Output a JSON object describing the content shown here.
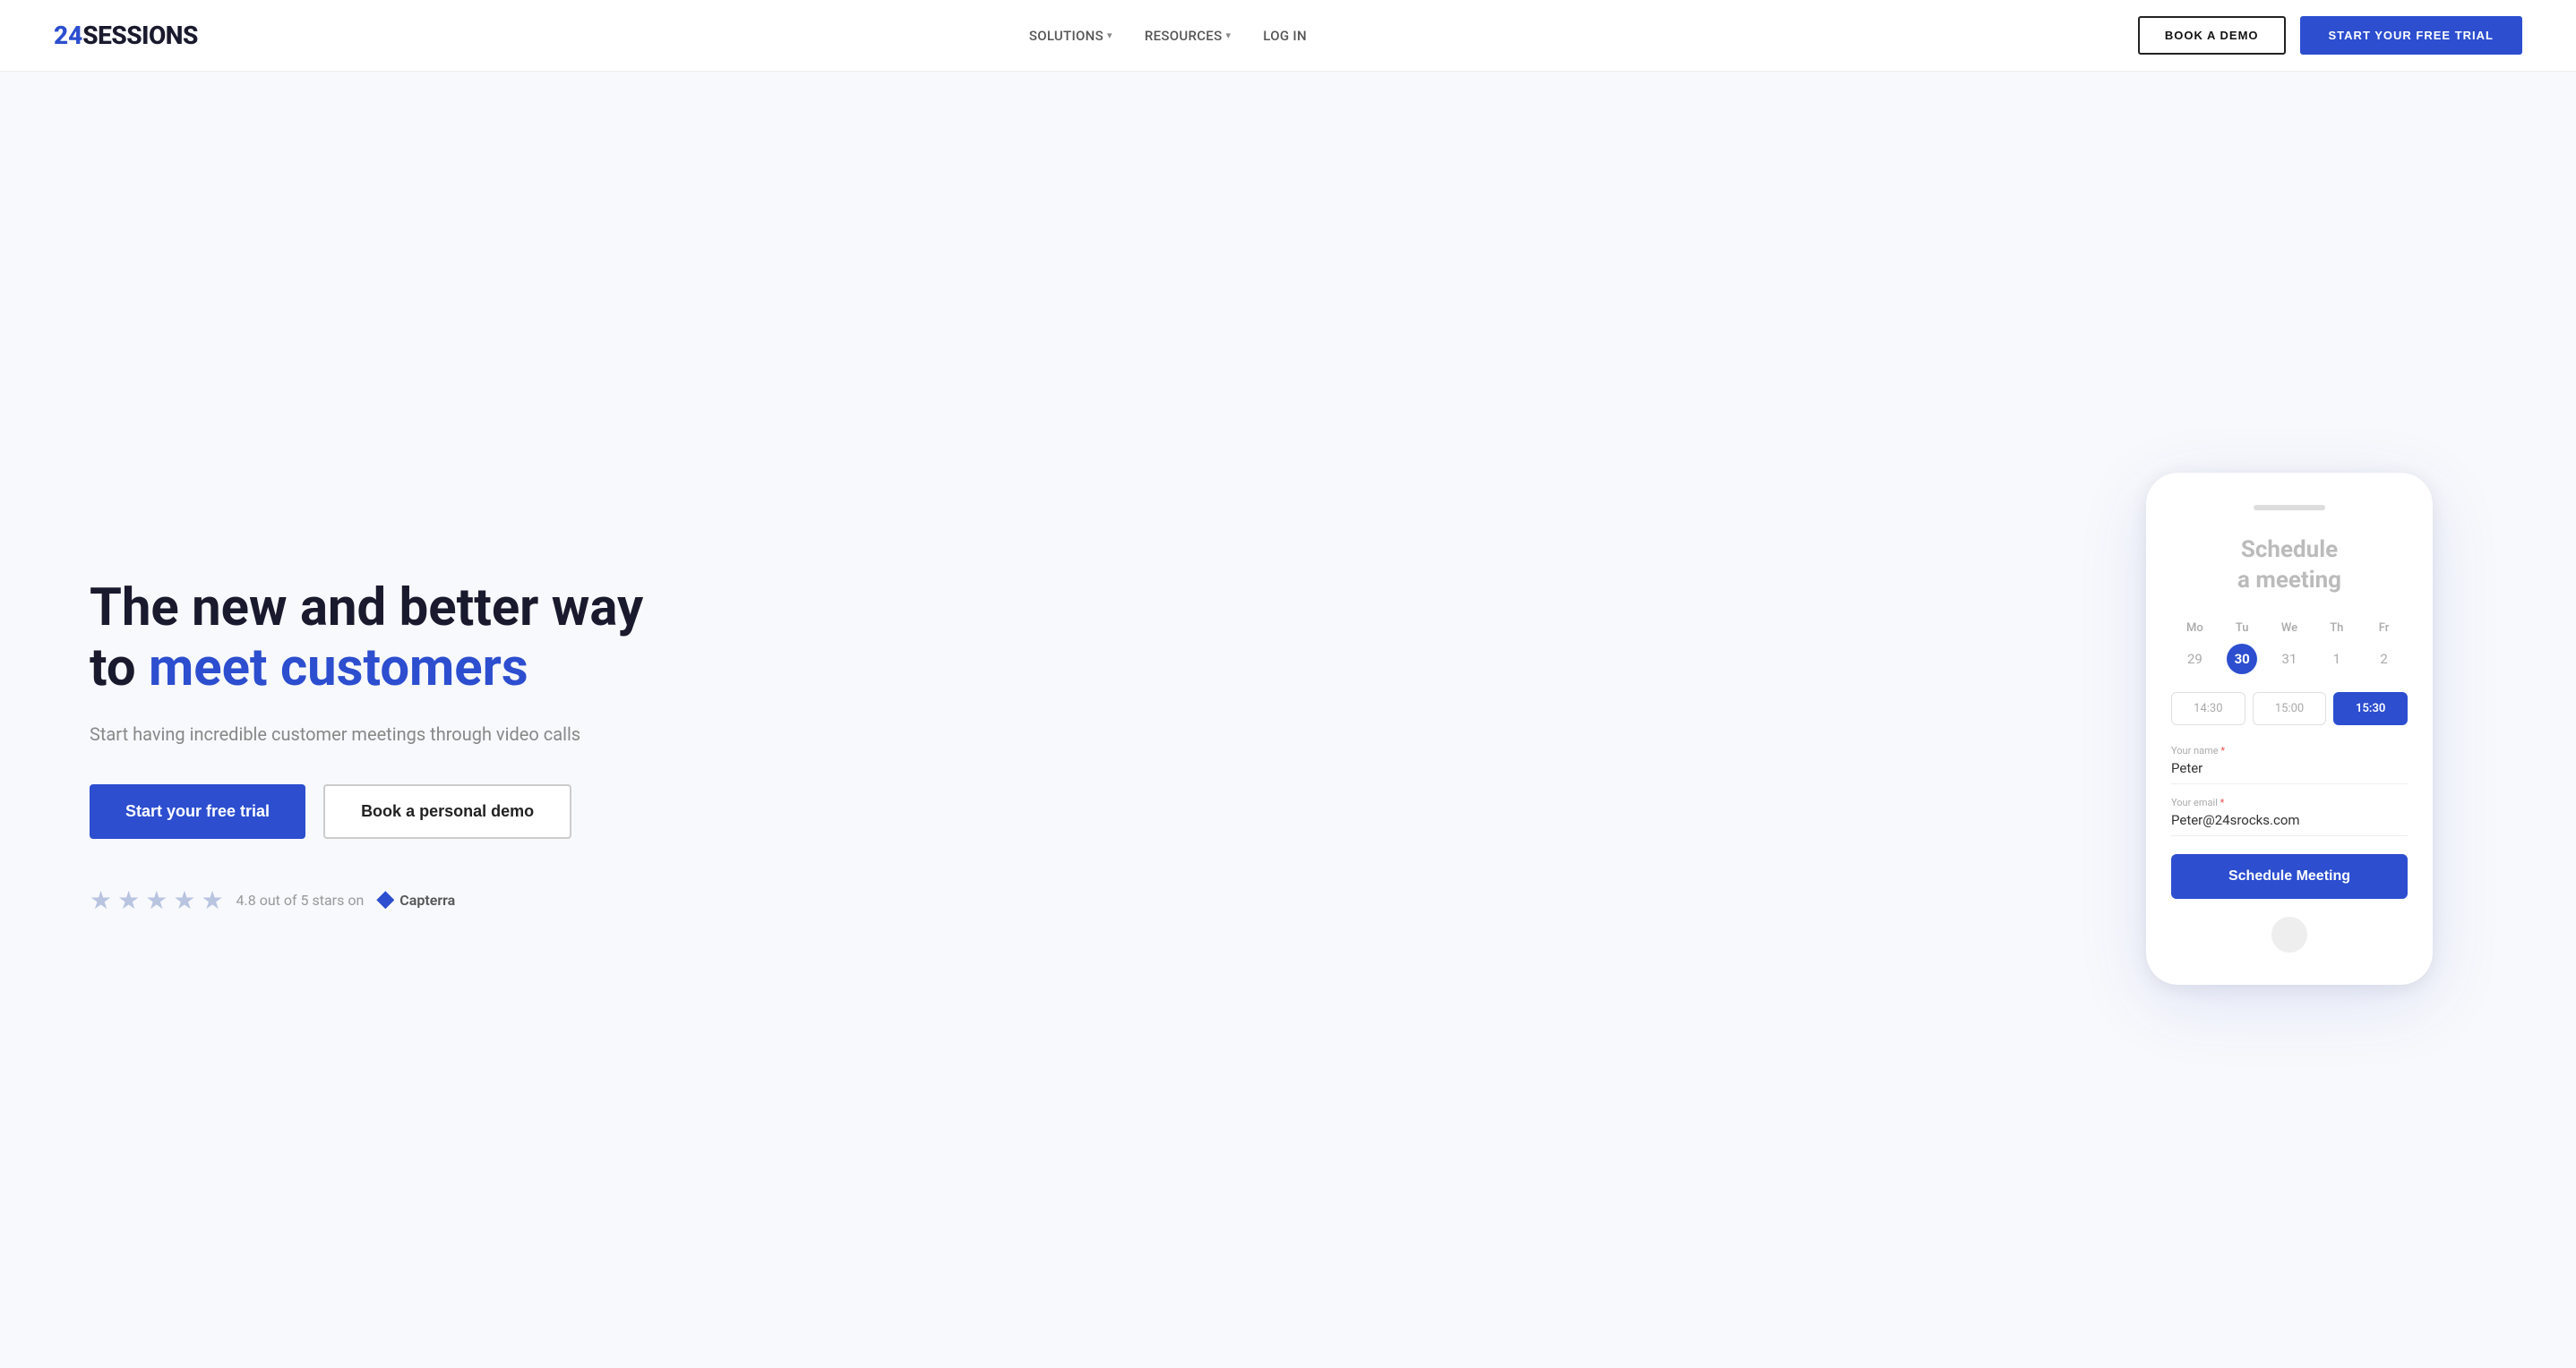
{
  "brand": {
    "logo_number": "24",
    "logo_text": "SESSIONS"
  },
  "nav": {
    "links": [
      {
        "label": "SOLUTIONS",
        "has_dropdown": true
      },
      {
        "label": "RESOURCES",
        "has_dropdown": true
      },
      {
        "label": "LOG IN",
        "has_dropdown": false
      }
    ],
    "book_demo_label": "BOOK A DEMO",
    "start_trial_label": "START YOUR FREE TRIAL"
  },
  "hero": {
    "title_line1": "The new and better way",
    "title_line2_plain": "to ",
    "title_line2_highlight": "meet customers",
    "subtitle": "Start having incredible customer meetings through video calls",
    "cta_primary": "Start your free trial",
    "cta_secondary": "Book a personal demo",
    "rating_text": "4.8 out of 5 stars on",
    "capterra_label": "Capterra"
  },
  "phone": {
    "title_line1": "Schedule",
    "title_line2": "a meeting",
    "calendar": {
      "days": [
        "Mo",
        "Tu",
        "We",
        "Th",
        "Fr"
      ],
      "dates": [
        "29",
        "30",
        "31",
        "1",
        "2"
      ],
      "active_index": 1
    },
    "time_slots": [
      {
        "label": "14:30",
        "selected": false
      },
      {
        "label": "15:00",
        "selected": false
      },
      {
        "label": "15:30",
        "selected": true
      }
    ],
    "form": {
      "name_label": "Your name",
      "name_required": "*",
      "name_value": "Peter",
      "email_label": "Your email",
      "email_required": "*",
      "email_value": "Peter@24srocks.com"
    },
    "schedule_btn_label": "Schedule Meeting"
  },
  "colors": {
    "brand_blue": "#2c4ecf",
    "text_dark": "#1a1a2e",
    "text_gray": "#888",
    "star_color": "#b8c4e0"
  }
}
